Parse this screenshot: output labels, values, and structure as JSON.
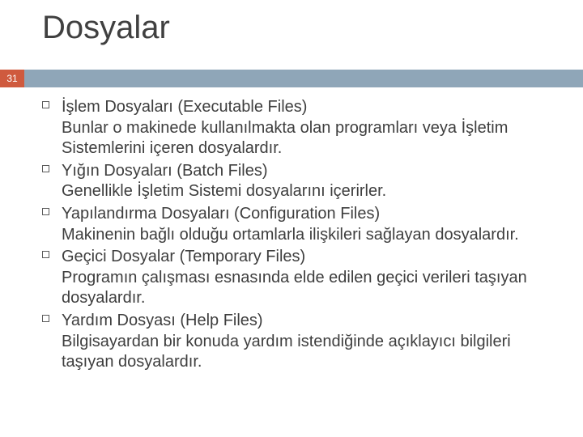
{
  "slide": {
    "title": "Dosyalar",
    "page_number": "31",
    "items": [
      {
        "lead": "İşlem Dosyaları (Executable Files)",
        "desc": "Bunlar o makinede kullanılmakta olan programları veya İşletim Sistemlerini içeren dosyalardır."
      },
      {
        "lead": "Yığın Dosyaları (Batch Files)",
        "desc": "Genellikle İşletim Sistemi dosyalarını içerirler."
      },
      {
        "lead": "Yapılandırma Dosyaları (Configuration Files)",
        "desc": "Makinenin bağlı olduğu ortamlarla ilişkileri sağlayan dosyalardır."
      },
      {
        "lead": "Geçici Dosyalar (Temporary Files)",
        "desc": "Programın çalışması esnasında elde edilen geçici verileri taşıyan dosyalardır."
      },
      {
        "lead": "Yardım Dosyası (Help Files)",
        "desc": "Bilgisayardan bir konuda yardım istendiğinde açıklayıcı bilgileri taşıyan dosyalardır."
      }
    ]
  }
}
